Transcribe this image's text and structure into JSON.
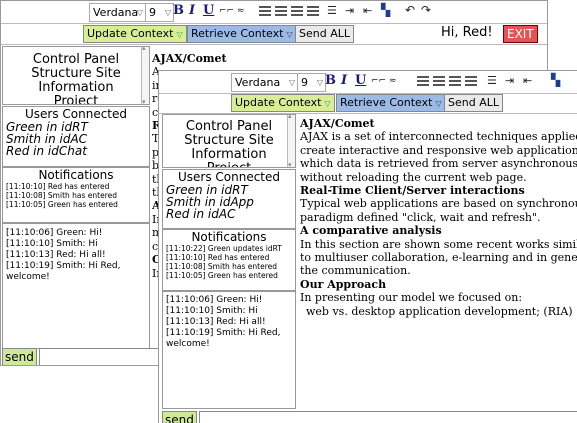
{
  "toolbar": {
    "font_name": "Verdana",
    "font_size": "9",
    "bold": "B",
    "italic": "I",
    "underline": "U",
    "update_context": "Update Context",
    "retrieve_context": "Retrieve Context",
    "send_all": "Send ALL",
    "greeting": "Hi, Red!",
    "exit": "EXIT"
  },
  "control_panel": {
    "title_line1": "Control Panel",
    "title_line2": "Structure Site",
    "title_line3": "Information",
    "title_line4": "Project"
  },
  "back_window": {
    "users_title": "Users Connected",
    "users": [
      "Green in idRT",
      "Smith in idAC",
      "Red in idChat"
    ],
    "notifications_title": "Notifications",
    "notifications": [
      "[11:10:10] Red has entered",
      "[11:10:08] Smith has entered",
      "[11:10:05] Green has entered"
    ],
    "chat": [
      "[11:10:06] Green: Hi!",
      "[11:10:10] Smith: Hi",
      "[11:10:13] Red: Hi all!",
      "[11:10:19] Smith: Hi Red,",
      "welcome!"
    ],
    "content_heading": "AJAX/Comet",
    "content_fragments": [
      "A",
      "in",
      "re",
      "cu",
      "R",
      "Ty",
      "pa",
      "br",
      "th",
      "th",
      "A",
      "In",
      "m",
      "co",
      "O",
      "In",
      "v"
    ],
    "send": "send"
  },
  "front_window": {
    "users_title": "Users Connected",
    "users": [
      "Green in idRT",
      "Smith in idApp",
      "Red in idAC"
    ],
    "notifications_title": "Notifications",
    "notifications": [
      "[11:10:22] Green updates idRT",
      "[11:10:10] Red has entered",
      "[11:10:08] Smith has entered",
      "[11:10:05] Green has entered"
    ],
    "chat": [
      "[11:10:06] Green: Hi!",
      "[11:10:10] Smith: Hi",
      "[11:10:13] Red: Hi all!",
      "[11:10:19] Smith: Hi Red,",
      "welcome!"
    ],
    "content": {
      "title": "AJAX/Comet",
      "p1": "AJAX is a set of interconnected techniques applied to create interactive and responsive web applications in which data is retrieved from server asynchronously without reloading the current web page.",
      "h2": "Real-Time Client/Server interactions",
      "p2": "Typical web applications are based on synchronous paradigm  defined \"click, wait and refresh\".",
      "h3": "A comparative analysis",
      "p3": "In this section are shown some recent works similar to multiuser collaboration, e-learning and in general the communication.",
      "h4": "Our Approach",
      "p4": "In presenting our model we focused on:",
      "p5": "web vs. desktop application development; (RIA)"
    },
    "send": "send"
  }
}
